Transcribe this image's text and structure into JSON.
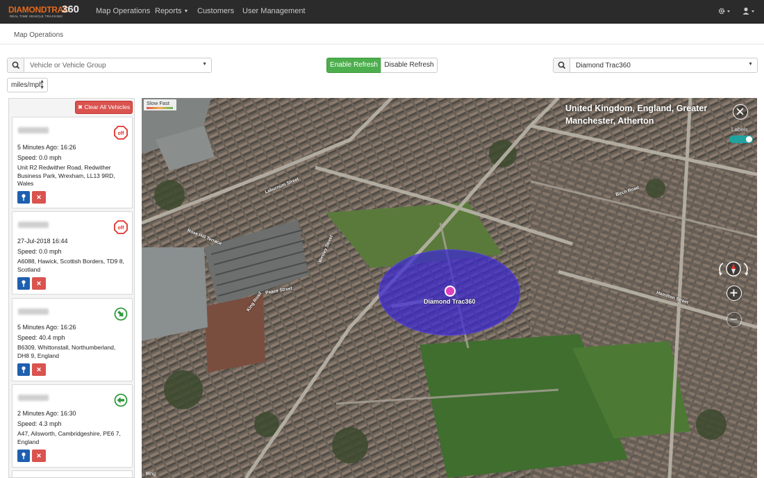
{
  "navbar": {
    "brand_main": "DIAMONDTRAC",
    "brand_num": "360",
    "brand_tag": "REAL TIME VEHICLE TRACKING",
    "items": [
      {
        "label": "Map Operations"
      },
      {
        "label": "Reports"
      },
      {
        "label": "Customers"
      },
      {
        "label": "User Management"
      }
    ]
  },
  "breadcrumb": "Map Operations",
  "vehicle_select": {
    "placeholder": "Vehicle or Vehicle Group"
  },
  "refresh": {
    "enable_label": "Enable Refresh",
    "disable_label": "Disable Refresh"
  },
  "customer_select": {
    "value": "Diamond Trac360"
  },
  "units": {
    "value": "miles/mph"
  },
  "left_panel": {
    "clear_label": "Clear All Vehicles",
    "vehicles": [
      {
        "time": "5 Minutes Ago: 16:26",
        "speed": "Speed: 0.0 mph",
        "address": "Unit R2 Redwither Road, Redwither Business Park, Wrexham, LL13 9RD, Wales",
        "status": "off"
      },
      {
        "time": "27-Jul-2018 16:44",
        "speed": "Speed: 0.0 mph",
        "address": "A6088, Hawick, Scottish Borders, TD9 8, Scotland",
        "status": "off"
      },
      {
        "time": "5 Minutes Ago: 16:26",
        "speed": "Speed: 40.4 mph",
        "address": "B6309, Whittonstall, Northumberland, DH8 9, England",
        "status": "moving"
      },
      {
        "time": "2 Minutes Ago: 16:30",
        "speed": "Speed: 4.3 mph",
        "address": "A47, Ailsworth, Cambridgeshire, PE6 7, England",
        "status": "moving"
      }
    ]
  },
  "map": {
    "speed_legend": "Slow  Fast",
    "location_title": "United Kingdom, England, Greater Manchester, Atherton",
    "labels_toggle": "Labels",
    "geofence_label": "Diamond Trac360",
    "attribution": "Bing",
    "street_labels": [
      "Laburnum Street",
      "Rose Hill Terrace",
      "Wesley Street",
      "Peace Street",
      "King Road",
      "Birch Road",
      "Hamilton Street"
    ]
  },
  "colors": {
    "navbar_bg": "#2b2b2b",
    "brand_orange": "#e46a1e",
    "btn_success": "#4cae4c",
    "btn_danger": "#d9534f",
    "btn_primary": "#1f5fb0",
    "geofence": "#3c28d2",
    "status_off": "#e0312a",
    "status_moving": "#2e9a3c"
  }
}
